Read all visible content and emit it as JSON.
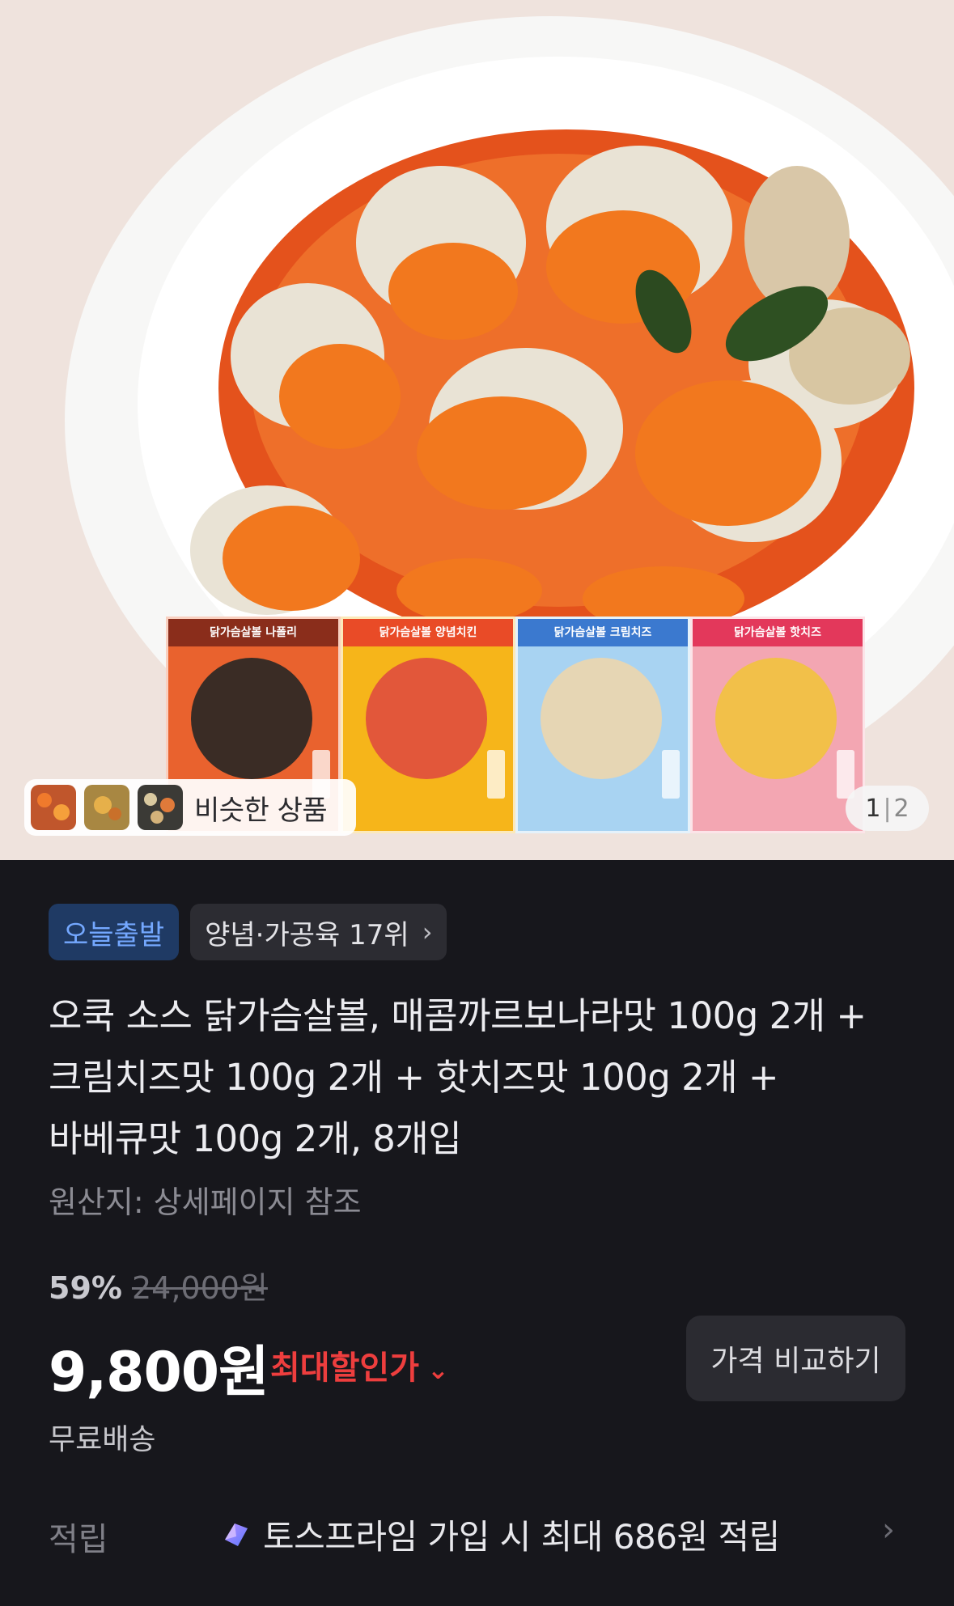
{
  "similar": {
    "label": "비슷한 상품"
  },
  "pager": {
    "current": "1",
    "total": "2"
  },
  "packs": [
    {
      "name": "닭가슴살볼 나폴리",
      "color": "#e9622e",
      "top": "#8a2d1b"
    },
    {
      "name": "닭가슴살볼 양념치킨",
      "color": "#f6a21a",
      "top": "#e94b27"
    },
    {
      "name": "닭가슴살볼 크림치즈",
      "color": "#9fcdf0",
      "top": "#3b79cf"
    },
    {
      "name": "닭가슴살볼 핫치즈",
      "color": "#f1a0ac",
      "top": "#e3385b"
    }
  ],
  "badges": {
    "today": "오늘출발",
    "rank": "양념·가공육 17위"
  },
  "product": {
    "title_line1": "오쿡 소스 닭가슴살볼, 매콤까르보나라맛 100g 2개 +",
    "title_line2": "크림치즈맛 100g 2개 + 핫치즈맛 100g 2개 +",
    "title_line3": "바베큐맛 100g 2개, 8개입",
    "origin": "원산지: 상세페이지 참조"
  },
  "pricing": {
    "discount_rate": "59%",
    "original_price": "24,000원",
    "price": "9,800원",
    "max_discount_label": "최대할인가",
    "compare_button": "가격 비교하기",
    "shipping": "무료배송"
  },
  "reward": {
    "label": "적립",
    "text": "토스프라임 가입 시 최대 686원 적립"
  },
  "colors": {
    "background": "#17171c",
    "accent_blue": "#74a8ff",
    "discount_red": "#ee3e3e"
  },
  "icons": [
    "chevron-right-icon",
    "chevron-down-icon",
    "toss-prime-icon"
  ]
}
